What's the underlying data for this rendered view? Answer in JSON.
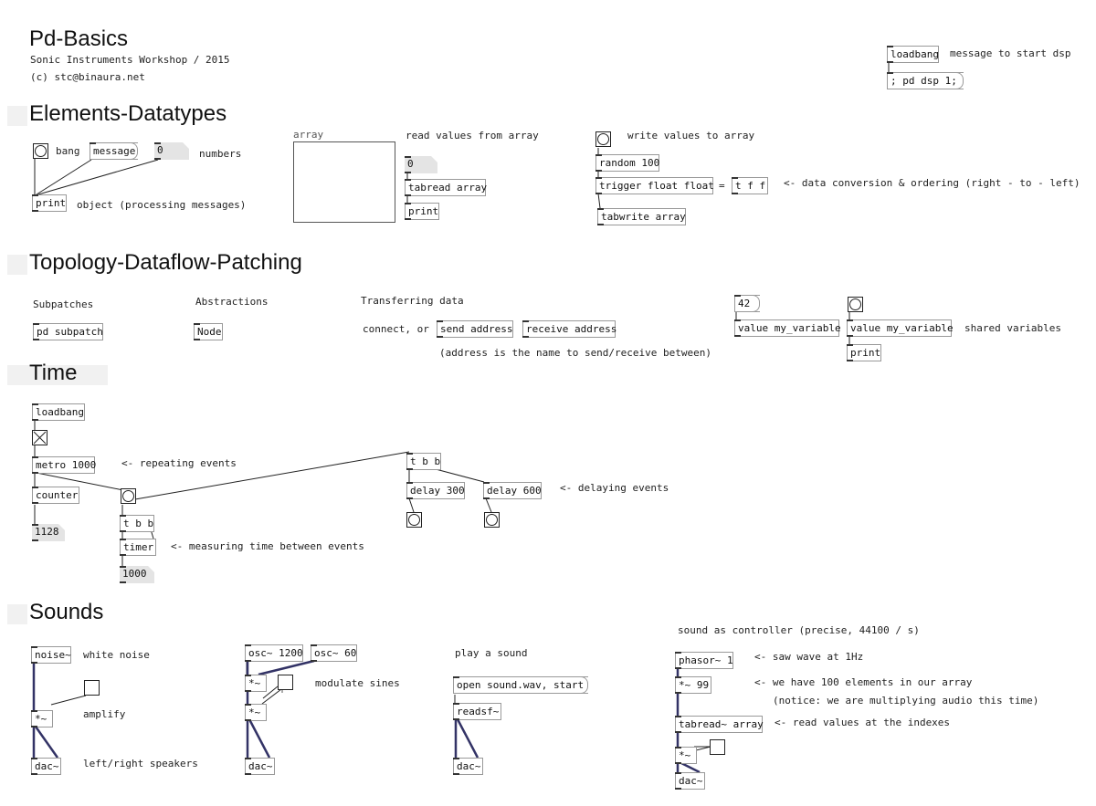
{
  "header": {
    "title": "Pd-Basics",
    "subtitle": "Sonic Instruments Workshop / 2015",
    "author": "(c) stc@binaura.net",
    "loadbang": "loadbang",
    "dsp_comment": "message to start dsp",
    "dsp_msg": "; pd dsp 1;"
  },
  "elements": {
    "heading": "Elements-Datatypes",
    "bang_label": "bang",
    "message_box": "message",
    "number_box": "0",
    "numbers_label": "numbers",
    "print": "print",
    "object_comment": "object (processing messages)",
    "array_label": "array",
    "read_comment": "read values from array",
    "read_number": "0",
    "tabread": "tabread array",
    "read_print": "print",
    "write_comment": "write values to array",
    "random": "random 100",
    "trigger": "trigger float float",
    "equals": "=",
    "tff": "t f f",
    "conversion_comment": "<- data conversion & ordering (right - to - left)",
    "tabwrite": "tabwrite array"
  },
  "topology": {
    "heading": "Topology-Dataflow-Patching",
    "subpatches": "Subpatches",
    "pd_subpatch": "pd subpatch",
    "abstractions": "Abstractions",
    "node": "Node",
    "transferring": "Transferring data",
    "connect": "connect, or",
    "send": "send address",
    "receive": "receive address",
    "address_comment": "(address is the name to send/receive between)",
    "msg42": "42",
    "value1": "value my_variable",
    "value2": "value my_variable",
    "shared": "shared variables",
    "print": "print"
  },
  "time": {
    "heading": "Time",
    "loadbang": "loadbang",
    "metro": "metro 1000",
    "repeating": "<- repeating events",
    "counter": "counter",
    "count_value": "1128",
    "tbb": "t b b",
    "timer": "timer",
    "measuring": "<- measuring time between events",
    "timer_value": "1000",
    "tbb2": "t b b",
    "delay300": "delay 300",
    "delay600": "delay 600",
    "delaying": "<- delaying events"
  },
  "sounds": {
    "heading": "Sounds",
    "noise": "noise~",
    "white_noise": "white noise",
    "mul1": "*~",
    "amplify": "amplify",
    "dac1": "dac~",
    "speakers": "left/right speakers",
    "osc1200": "osc~ 1200",
    "osc60": "osc~ 60",
    "mul2": "*~",
    "modulate": "modulate sines",
    "mul3": "*~",
    "dac2": "dac~",
    "play_sound": "play a sound",
    "open_msg": "open sound.wav, start",
    "readsf": "readsf~",
    "dac3": "dac~",
    "controller": "sound as controller (precise, 44100 / s)",
    "phasor": "phasor~ 1",
    "saw": "<- saw wave at 1Hz",
    "mul99": "*~ 99",
    "hundred": "<- we have 100 elements in our array",
    "notice": "(notice: we are multiplying audio this time)",
    "tabread": "tabread~ array",
    "read_indexes": "<- read values at the indexes",
    "mul4": "*~",
    "dac4": "dac~"
  }
}
